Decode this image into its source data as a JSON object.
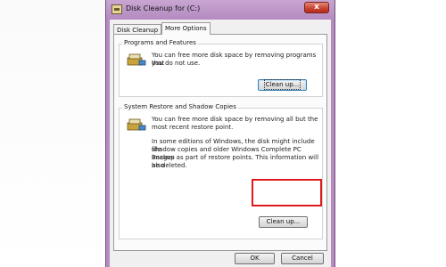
{
  "window": {
    "title": "Disk Cleanup for  (C:)",
    "close_glyph": "x"
  },
  "tabs": [
    {
      "label": "Disk Cleanup",
      "active": false
    },
    {
      "label": "More Options",
      "active": true
    }
  ],
  "programs_group": {
    "label": "Programs and Features",
    "description_line1": "You can free more disk space by removing programs that",
    "description_line2": "you do not use.",
    "icon": "programs-icon",
    "button_label": "Clean up..."
  },
  "restore_group": {
    "label": "System Restore and Shadow Copies",
    "description_line1": "You can free more disk space by removing all but the",
    "description_line2": "most recent restore point.",
    "note_line1": "In some editions of Windows, the disk might include file",
    "note_line2": "shadow copies and older Windows Complete PC Backup",
    "note_line3": "images as part of restore points. This information will also",
    "note_line4": "be deleted.",
    "icon": "restore-icon",
    "button_label": "Clean up...",
    "highlight_color": "#e01a1a"
  },
  "footer": {
    "ok_label": "OK",
    "cancel_label": "Cancel"
  }
}
